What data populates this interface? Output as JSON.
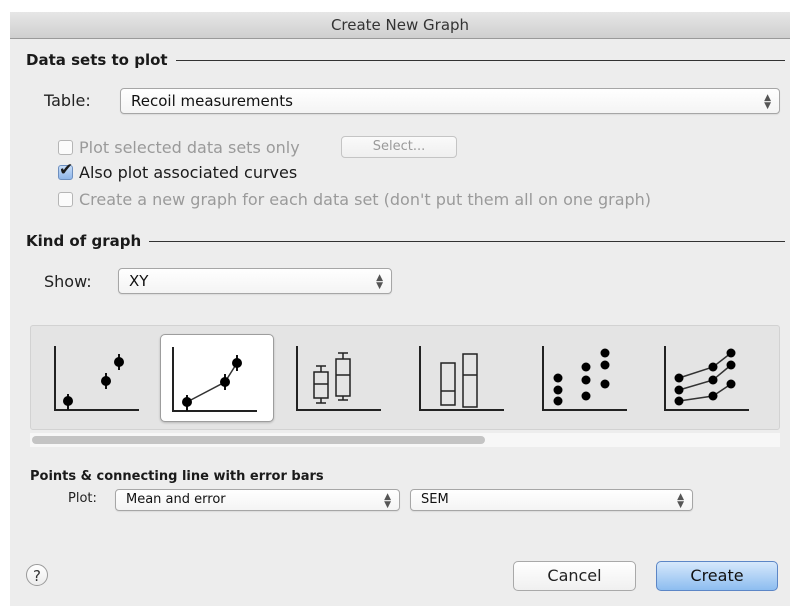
{
  "window": {
    "title": "Create New Graph"
  },
  "data_sets": {
    "heading": "Data sets to plot",
    "table_label": "Table:",
    "table_value": "Recoil measurements",
    "options": [
      {
        "label": "Plot selected data sets only",
        "checked": false,
        "enabled": false
      },
      {
        "label": "Also plot associated curves",
        "checked": true,
        "enabled": true
      },
      {
        "label": "Create a new graph for each data set (don't put them all on one graph)",
        "checked": false,
        "enabled": false
      }
    ],
    "select_button": "Select..."
  },
  "kind": {
    "heading": "Kind of graph",
    "show_label": "Show:",
    "show_value": "XY",
    "gallery": [
      {
        "name": "points-with-error-bars",
        "selected": false
      },
      {
        "name": "points-connecting-line-error-bars",
        "selected": true
      },
      {
        "name": "box-and-whiskers",
        "selected": false
      },
      {
        "name": "floating-bars",
        "selected": false
      },
      {
        "name": "scatter-columns",
        "selected": false
      },
      {
        "name": "multiple-lines",
        "selected": false
      }
    ],
    "scroll_position": 0.0,
    "scroll_visible_fraction": 0.6
  },
  "plot_options": {
    "heading": "Points & connecting line with error bars",
    "plot_label": "Plot:",
    "plot_value": "Mean and error",
    "error_value": "SEM"
  },
  "footer": {
    "help_glyph": "?",
    "cancel": "Cancel",
    "create": "Create"
  },
  "colors": {
    "default_button": "#8dbdf0",
    "window_bg": "#ededed"
  }
}
